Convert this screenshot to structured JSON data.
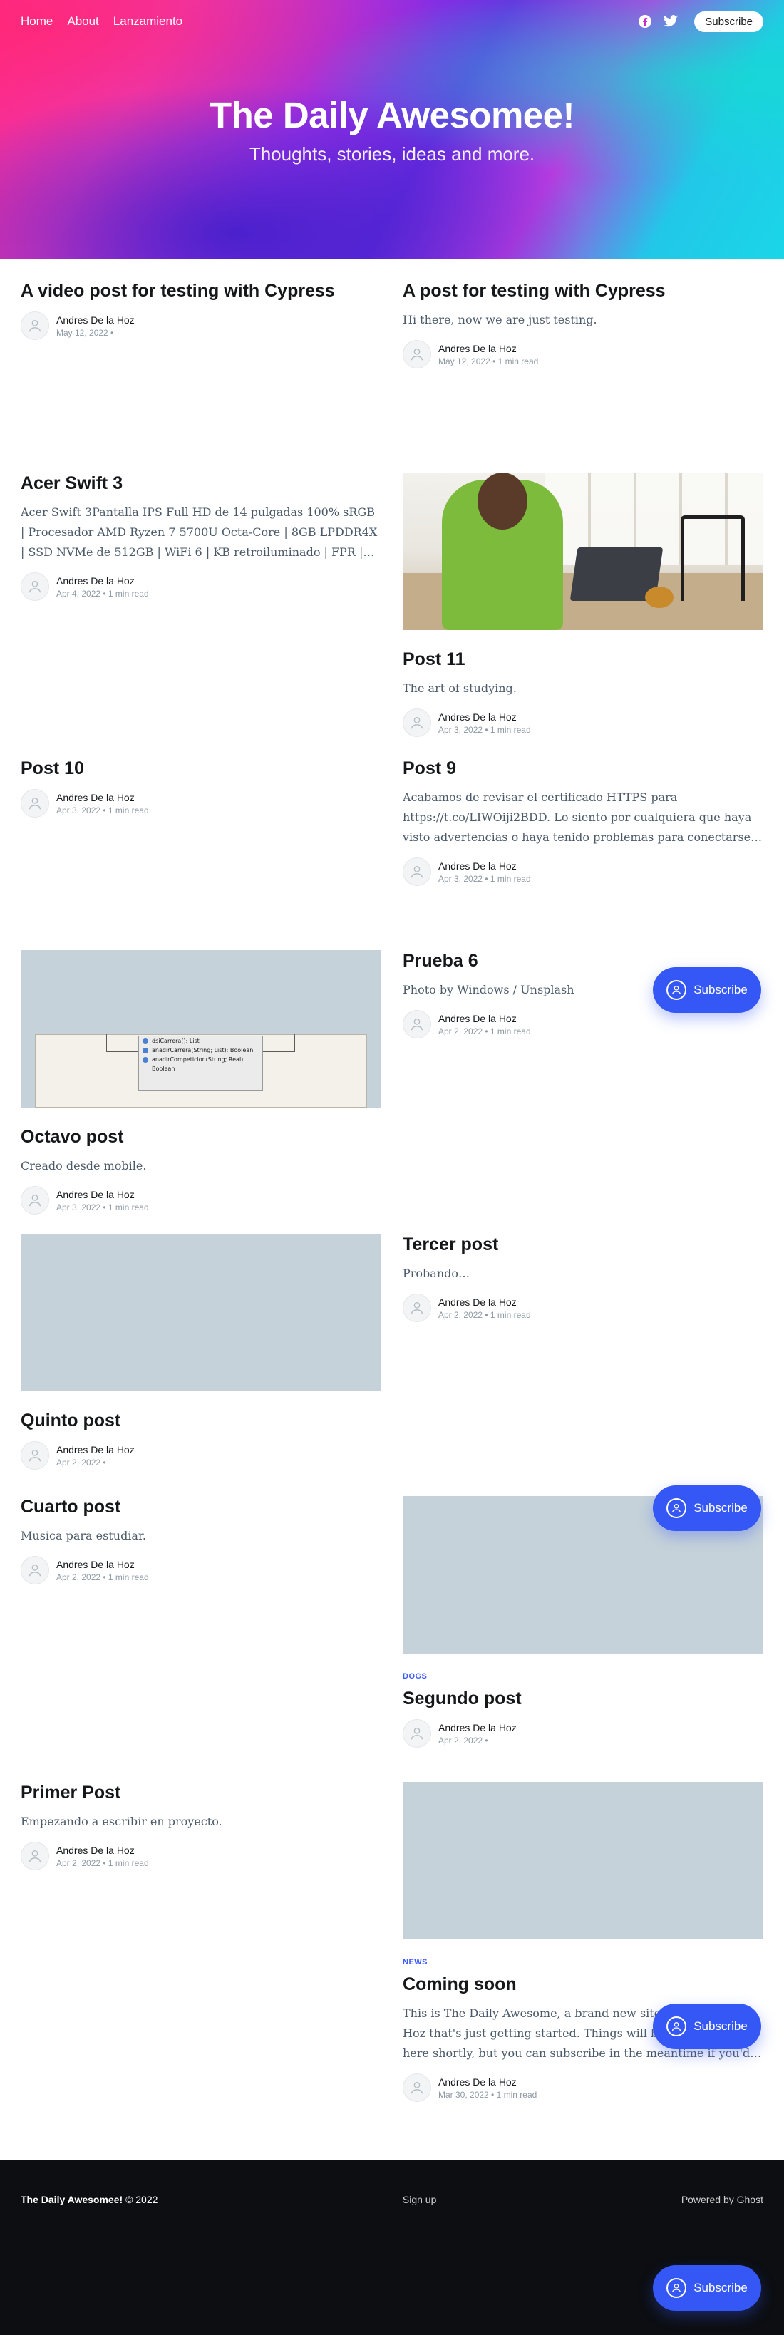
{
  "nav": {
    "links": [
      "Home",
      "About",
      "Lanzamiento"
    ],
    "subscribe_label": "Subscribe"
  },
  "hero": {
    "title": "The Daily Awesomee!",
    "subtitle": "Thoughts, stories, ideas and more."
  },
  "posts": [
    {
      "title": "A video post for testing with Cypress",
      "excerpt": "",
      "author": "Andres De la Hoz",
      "date": "May 12, 2022",
      "read": "",
      "tag": ""
    },
    {
      "title": "A post for testing with Cypress",
      "excerpt": "Hi there, now we are just testing.",
      "author": "Andres De la Hoz",
      "date": "May 12, 2022",
      "read": "1 min read",
      "tag": ""
    },
    {
      "title": "Acer Swift 3",
      "excerpt": "Acer Swift 3Pantalla IPS Full HD de 14 pulgadas 100% sRGB | Procesador AMD Ryzen 7 5700U Octa-Core | 8GB LPDDR4X | SSD NVMe de 512GB | WiFi 6 | KB retroiluminado | FPR |…",
      "author": "Andres De la Hoz",
      "date": "Apr 4, 2022",
      "read": "1 min read",
      "tag": ""
    },
    {
      "title": "Post 11",
      "excerpt": "The art of studying.",
      "author": "Andres De la Hoz",
      "date": "Apr 3, 2022",
      "read": "1 min read",
      "tag": ""
    },
    {
      "title": "Post 10",
      "excerpt": "",
      "author": "Andres De la Hoz",
      "date": "Apr 3, 2022",
      "read": "1 min read",
      "tag": ""
    },
    {
      "title": "Post 9",
      "excerpt": "Acabamos de revisar el certificado HTTPS para https://t.co/LIWOiji2BDD. Lo siento por cualquiera que haya visto advertencias o haya tenido problemas para conectarse…",
      "author": "Andres De la Hoz",
      "date": "Apr 3, 2022",
      "read": "1 min read",
      "tag": ""
    },
    {
      "title": "Octavo post",
      "excerpt": "Creado desde mobile.",
      "author": "Andres De la Hoz",
      "date": "Apr 3, 2022",
      "read": "1 min read",
      "tag": ""
    },
    {
      "title": "Prueba 6",
      "excerpt": "Photo by Windows / Unsplash",
      "author": "Andres De la Hoz",
      "date": "Apr 2, 2022",
      "read": "1 min read",
      "tag": ""
    },
    {
      "title": "Quinto post",
      "excerpt": "",
      "author": "Andres De la Hoz",
      "date": "Apr 2, 2022",
      "read": "",
      "tag": ""
    },
    {
      "title": "Tercer post",
      "excerpt": "Probando…",
      "author": "Andres De la Hoz",
      "date": "Apr 2, 2022",
      "read": "1 min read",
      "tag": ""
    },
    {
      "title": "Cuarto post",
      "excerpt": "Musica para estudiar.",
      "author": "Andres De la Hoz",
      "date": "Apr 2, 2022",
      "read": "1 min read",
      "tag": ""
    },
    {
      "title": "Segundo post",
      "excerpt": "",
      "author": "Andres De la Hoz",
      "date": "Apr 2, 2022",
      "read": "",
      "tag": "DOGS"
    },
    {
      "title": "Primer Post",
      "excerpt": "Empezando a escribir en proyecto.",
      "author": "Andres De la Hoz",
      "date": "Apr 2, 2022",
      "read": "1 min read",
      "tag": ""
    },
    {
      "title": "Coming soon",
      "excerpt": "This is The Daily Awesome, a brand new site by Andres De la Hoz that's just getting started. Things will be up and running here shortly, but you can subscribe in the meantime if you'd lik…",
      "author": "Andres De la Hoz",
      "date": "Mar 30, 2022",
      "read": "1 min read",
      "tag": "NEWS"
    }
  ],
  "diagram_lines": [
    "dsiCarrera(): List",
    "anadirCarrera(String; List): Boolean",
    "anadirCompeticion(String; Real): Boolean"
  ],
  "float_subscribe_label": "Subscribe",
  "footer": {
    "site": "The Daily Awesomee!",
    "copyright": "© 2022",
    "signup": "Sign up",
    "powered": "Powered by Ghost"
  },
  "colors": {
    "accent": "#3557f5",
    "tag": "#3d5afe",
    "footer_bg": "#0c0e11",
    "placeholder": "#c5d2d9"
  }
}
